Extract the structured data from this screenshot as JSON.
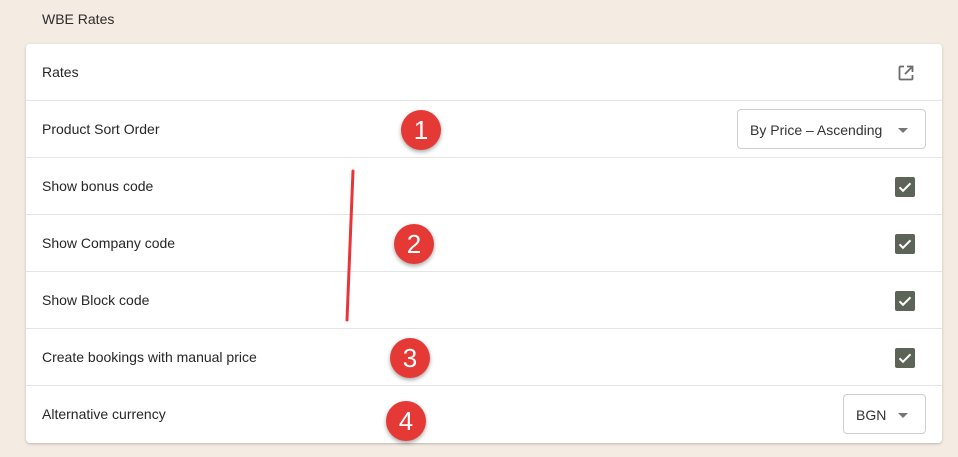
{
  "page": {
    "section_title": "WBE Rates"
  },
  "rows": {
    "rates": {
      "label": "Rates",
      "icon": "open-in-new-icon"
    },
    "product_sort_order": {
      "label": "Product Sort Order",
      "selected": "By Price – Ascending"
    },
    "show_bonus_code": {
      "label": "Show bonus code",
      "checked": true
    },
    "show_company_code": {
      "label": "Show Company code",
      "checked": true
    },
    "show_block_code": {
      "label": "Show Block code",
      "checked": true
    },
    "manual_price": {
      "label": "Create bookings with manual price",
      "checked": true
    },
    "alt_currency": {
      "label": "Alternative currency",
      "selected": "BGN"
    }
  },
  "annotations": {
    "markers": [
      "1",
      "2",
      "3",
      "4"
    ],
    "color": "#e53935"
  },
  "colors": {
    "background": "#f4ebe2",
    "checkbox": "#5b6457"
  }
}
